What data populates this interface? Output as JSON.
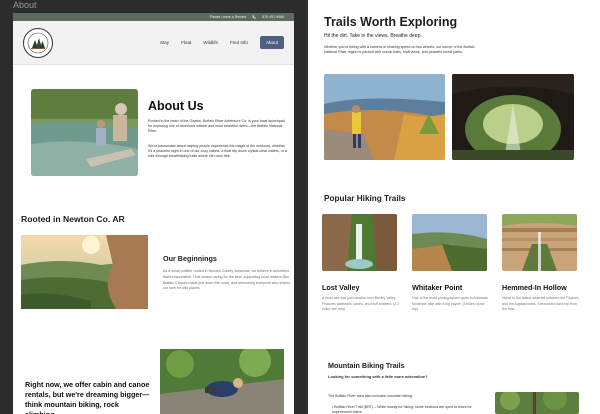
{
  "canvas": {
    "frame_label": "About"
  },
  "about_page": {
    "topbar": {
      "note": "Please Leave a Review",
      "phone": "870-451-9669"
    },
    "nav": {
      "items": [
        "Stay",
        "Float",
        "Wildlife",
        "Find Info"
      ],
      "cta": "About"
    },
    "about": {
      "title": "About Us",
      "p1": "Rooted in the heart of the Ozarks, Buffalo River Adventure Co. is your local launchpad for exploring one of America's wildest and most beautiful rivers—the Buffalo National River.",
      "p2": "We're passionate about helping people experience the magic of the outdoors, whether it's a peaceful night in one of our cozy cabins, a float trip down crystal-clear waters, or a hike through breathtaking trails where elk roam free."
    },
    "rooted": {
      "title": "Rooted in Newton Co. AR",
      "beginnings_title": "Our Beginnings",
      "beginnings_text": "As a small outfitter rooted in Newton County, Arkansas, we believe in adventure that's responsible. That means caring for the land, supporting local makers (like Buffalo Canoes made just down the road), and welcoming everyone who shares our love for wild places."
    },
    "bottom": {
      "text": "Right now, we offer cabin and canoe rentals, but we're dreaming bigger—think mountain biking, rock climbing"
    }
  },
  "trails_page": {
    "title": "Trails Worth Exploring",
    "subtitle": "Hit the dirt. Take in the views. Breathe deep.",
    "intro": "Whether you're hiking with a camera or chasing speed on two wheels, our corner of the Buffalo National River region is packed with scenic trails, bluff views, and peaceful forest paths.",
    "popular_title": "Popular Hiking Trails",
    "trails": [
      {
        "name": "Lost Valley",
        "desc": "A must-see trail just minutes from Boxley Valley. Features waterfalls, caves, and bluff shelters. (2.3 miles one way)"
      },
      {
        "name": "Whitaker Point",
        "desc": "One of the most photographed spots in Arkansas. Moderate hike with a big payoff. (3 miles round trip)"
      },
      {
        "name": "Hemmed-In Hollow",
        "desc": "Home to the tallest waterfall between the Rockies and the Appalachians. Strenuous round trip from the river."
      }
    ],
    "mtb": {
      "title": "Mountain Biking Trails",
      "subtitle": "Looking for something with a little more adrenaline?",
      "intro": "The Buffalo River area also includes mountain biking:",
      "bullet": "Buffalo River Trail (BRT) – While mostly for hiking, some sections are open to bikes for experienced riders."
    }
  },
  "colors": {
    "topbar": "#5c6b5e",
    "nav_cta": "#4f6082",
    "canvas_bg": "#2c2c2c"
  }
}
